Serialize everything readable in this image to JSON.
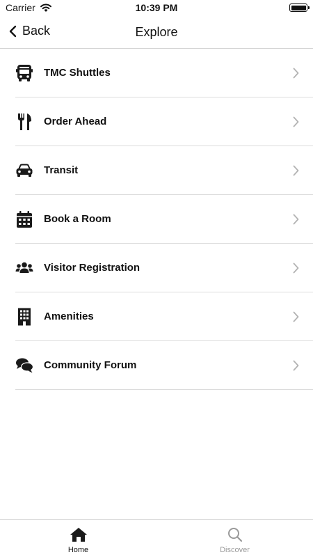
{
  "status_bar": {
    "carrier": "Carrier",
    "time": "10:39 PM",
    "battery_icon": "battery-full-icon",
    "signal_icon": "wifi-icon"
  },
  "nav": {
    "back_label": "Back",
    "title": "Explore",
    "back_icon": "chevron-left-icon"
  },
  "menu": {
    "items": [
      {
        "label": "TMC Shuttles",
        "icon": "bus-icon"
      },
      {
        "label": "Order Ahead",
        "icon": "utensils-icon"
      },
      {
        "label": "Transit",
        "icon": "car-icon"
      },
      {
        "label": "Book a Room",
        "icon": "calendar-icon"
      },
      {
        "label": "Visitor Registration",
        "icon": "users-icon"
      },
      {
        "label": "Amenities",
        "icon": "building-icon"
      },
      {
        "label": "Community Forum",
        "icon": "comments-icon"
      }
    ],
    "chevron_icon": "chevron-right-icon"
  },
  "tab_bar": {
    "tabs": [
      {
        "label": "Home",
        "icon": "home-icon",
        "active": true
      },
      {
        "label": "Discover",
        "icon": "search-icon",
        "active": false
      }
    ]
  },
  "colors": {
    "text": "#111111",
    "inactive": "#9a9a9a",
    "divider": "#dcdcdc",
    "chevron": "#b3b3b3"
  }
}
